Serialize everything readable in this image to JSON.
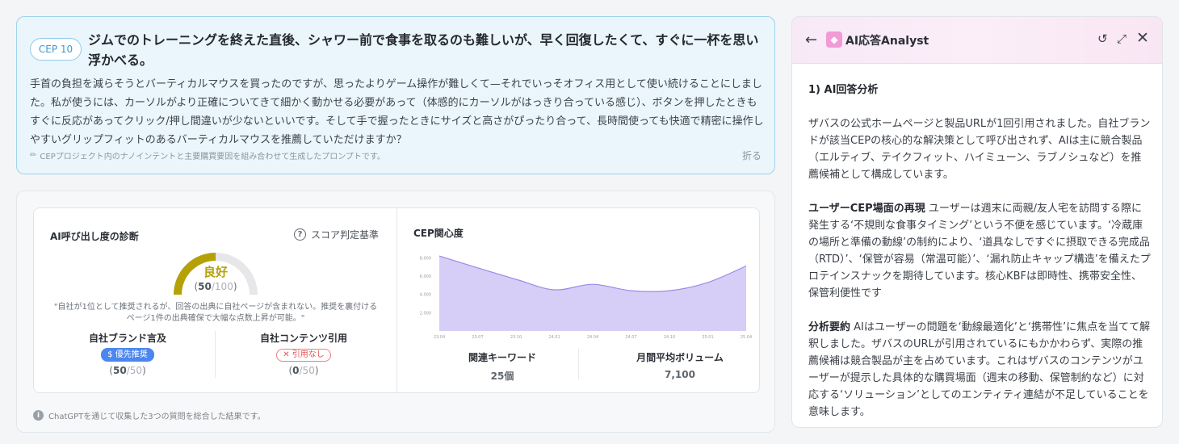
{
  "cep": {
    "badge": "CEP 10",
    "title": "ジムでのトレーニングを終えた直後、シャワー前で食事を取るのも難しいが、早く回復したくて、すぐに一杯を思い浮かべる。",
    "body": "手首の負担を減らそうとバーティカルマウスを買ったのですが、思ったよりゲーム操作が難しくて—それでいっそオフィス用として使い続けることにしました。私が使うには、カーソルがより正確についてきて細かく動かせる必要があって（体感的にカーソルがはっきり合っている感じ）、ボタンを押したときもすぐに反応があってクリック/押し間違いが少ないといいです。そして手で握ったときにサイズと高さがぴったり合って、長時間使っても快適で精密に操作しやすいグリップフィットのあるバーティカルマウスを推薦していただけますか？",
    "note": "CEPプロジェクト内のナノインテントと主要購買要因を組み合わせて生成したプロンプトです。",
    "fold": "折る",
    "note_icon": "pencil-icon"
  },
  "diagnosis": {
    "title": "AI呼び出し度の診断",
    "criteria": "スコア判定基準",
    "gauge": {
      "label": "良好",
      "score": "50",
      "max": "/100",
      "value": 0.5,
      "color": "#b5a106"
    },
    "quote": "\"自社が1位として推奨されるが、回答の出典に自社ページが含まれない。推奨を裏付けるページ1件の出典確保で大幅な点数上昇が可能。\"",
    "brand": {
      "name": "自社ブランド言及",
      "badge": "$ 優先推奨",
      "score": "50",
      "max": "/50"
    },
    "content": {
      "name": "自社コンテンツ引用",
      "badge": "✕ 引用なし",
      "score": "0",
      "max": "/50"
    }
  },
  "interest": {
    "title": "CEP関心度",
    "keywords": {
      "name": "関連キーワード",
      "value": "25個"
    },
    "volume": {
      "name": "月間平均ボリューム",
      "value": "7,100"
    }
  },
  "chart_data": {
    "type": "area",
    "title": "CEP関心度",
    "color": "#c9bdf5",
    "line_color": "#9d88e6",
    "y_ticks": [
      "8,000",
      "6,000",
      "4,000",
      "2,000"
    ],
    "y_tick_values": [
      8000,
      6000,
      4000,
      2000
    ],
    "x_ticks": [
      "23.04",
      "23.07",
      "23.10",
      "24.01",
      "24.04",
      "24.07",
      "24.10",
      "25.01",
      "25.04"
    ],
    "ylim": [
      0,
      9000
    ],
    "x": [
      0,
      1,
      2,
      3,
      4,
      5,
      6,
      7,
      8
    ],
    "values": [
      8200,
      6900,
      5650,
      4500,
      5100,
      4400,
      4400,
      5300,
      7100
    ]
  },
  "footer": "ChatGPTを通じて収集した3つの質問を総合した結果です。",
  "ai": {
    "title": "AI応答Analyst",
    "section1": "1) AI回答分析",
    "p1": "ザバスの公式ホームページと製品URLが1回引用されました。自社ブランドが該当CEPの核心的な解決策として呼び出されず、AIは主に競合製品（エルティブ、テイクフィット、ハイミューン、ラブノシュなど）を推薦候補として構成しています。",
    "h2": "ユーザーCEP場面の再現",
    "p2": "ユーザーは週末に両親/友人宅を訪問する際に発生する‘不規則な食事タイミング’という不便を感じています。‘冷蔵庫の場所と準備の動線’の制約により、‘道具なしですぐに摂取できる完成品（RTD）’、‘保管が容易（常温可能）’、‘漏れ防止キャップ構造’を備えたプロテインスナックを期待しています。核心KBFは即時性、携帯安全性、保管利便性です",
    "h3": "分析要約",
    "p3": "AIはユーザーの問題を‘動線最適化’と‘携帯性’に焦点を当てて解釈しました。ザバスのURLが引用されているにもかかわらず、実際の推薦候補は競合製品が主を占めています。これはザバスのコンテンツがユーザーが提示した具体的な購買場面（週末の移動、保管制約など）に対応する‘ソリューション’としてのエンティティ連結が不足していることを意味します。"
  }
}
